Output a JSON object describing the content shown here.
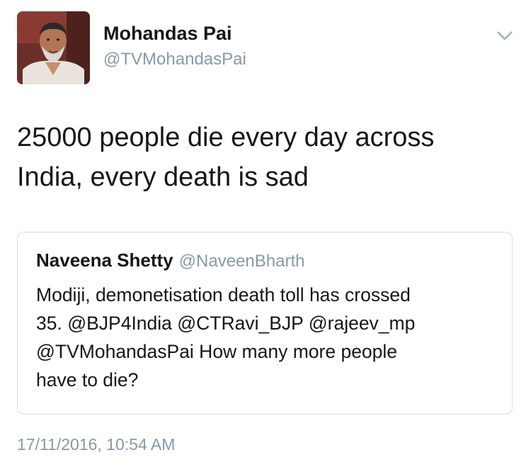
{
  "tweet": {
    "author": {
      "name": "Mohandas Pai",
      "handle": "@TVMohandasPai"
    },
    "text": "25000 people die every day across\nIndia, every death is sad",
    "timestamp": "17/11/2016, 10:54 AM"
  },
  "quoted_tweet": {
    "author": {
      "name": "Naveena Shetty",
      "handle": "@NaveenBharth"
    },
    "text": "Modiji, demonetisation death toll has crossed\n35. @BJP4India @CTRavi_BJP @rajeev_mp\n@TVMohandasPai How many more people\nhave to die?"
  },
  "icons": {
    "avatar": "profile-photo",
    "menu": "chevron-down-icon"
  },
  "colors": {
    "text": "#14171a",
    "secondary_text": "#8899a6",
    "border": "#d9dfe4"
  }
}
